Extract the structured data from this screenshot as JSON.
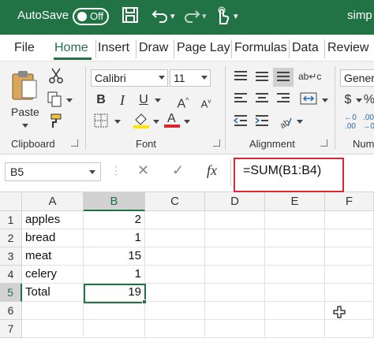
{
  "titlebar": {
    "autosave_label": "AutoSave",
    "autosave_state": "Off",
    "file_title": "simp"
  },
  "tabs": [
    "File",
    "Home",
    "Insert",
    "Draw",
    "Page Lay",
    "Formulas",
    "Data",
    "Review"
  ],
  "active_tab": "Home",
  "ribbon": {
    "clipboard": {
      "paste_label": "Paste",
      "group_label": "Clipboard"
    },
    "font": {
      "font_name": "Calibri",
      "font_size": "11",
      "group_label": "Font"
    },
    "alignment": {
      "group_label": "Alignment",
      "wrap_text_icon": "ab↵c"
    },
    "number": {
      "format": "Gener",
      "group_label": "Num"
    }
  },
  "formula_bar": {
    "name_box": "B5",
    "fx_label": "fx",
    "formula": "=SUM(B1:B4)"
  },
  "grid": {
    "columns": [
      "A",
      "B",
      "C",
      "D",
      "E",
      "F"
    ],
    "selected_column": "B",
    "selected_row": 5,
    "rows": [
      {
        "num": "1",
        "a": "apples",
        "b": "2"
      },
      {
        "num": "2",
        "a": "bread",
        "b": "1"
      },
      {
        "num": "3",
        "a": "meat",
        "b": "15"
      },
      {
        "num": "4",
        "a": "celery",
        "b": "1"
      },
      {
        "num": "5",
        "a": "Total",
        "b": "19"
      },
      {
        "num": "6",
        "a": "",
        "b": ""
      },
      {
        "num": "7",
        "a": "",
        "b": ""
      }
    ]
  },
  "colors": {
    "excel_green": "#217346",
    "highlight_red": "#d9282f",
    "font_color_bar": "#d9282f",
    "fill_color_bar": "#ffe600"
  }
}
